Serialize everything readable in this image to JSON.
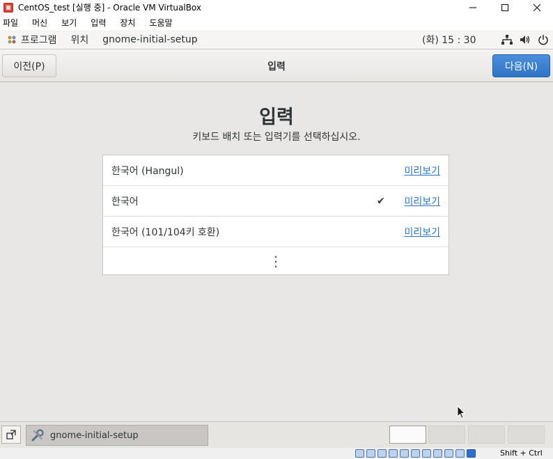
{
  "window": {
    "title": "CentOS_test [실행 중] - Oracle VM VirtualBox",
    "app_icon": "virtualbox-icon",
    "controls": [
      "minimize",
      "maximize",
      "close"
    ]
  },
  "vb_menu": {
    "items": [
      "파일",
      "머신",
      "보기",
      "입력",
      "장치",
      "도움말"
    ]
  },
  "gnome_top": {
    "apps_label": "프로그램",
    "places_label": "위치",
    "app_name": "gnome-initial-setup",
    "clock": "(화) 15 : 30",
    "status_icons": [
      "network-icon",
      "volume-icon",
      "power-icon"
    ]
  },
  "header": {
    "prev_label": "이전(P)",
    "title": "입력",
    "next_label": "다음(N)"
  },
  "page": {
    "heading": "입력",
    "description": "키보드 배치 또는 입력기를 선택하십시오."
  },
  "input_list": {
    "items": [
      {
        "label": "한국어 (Hangul)",
        "selected": false,
        "preview_label": "미리보기"
      },
      {
        "label": "한국어",
        "selected": true,
        "check_symbol": "✔",
        "preview_label": "미리보기"
      },
      {
        "label": "한국어 (101/104키 호환)",
        "selected": false,
        "preview_label": "미리보기"
      }
    ],
    "more_symbol": "⋮"
  },
  "taskbar": {
    "window_label": "gnome-initial-setup",
    "workspaces": [
      {
        "active": true
      },
      {
        "active": false
      },
      {
        "active": false
      },
      {
        "active": false
      }
    ]
  },
  "vb_status": {
    "host_key": "Shift + Ctrl"
  },
  "colors": {
    "accent_blue": "#2f74c9",
    "link_blue": "#2a76c6",
    "content_bg": "#e8e7e5",
    "text": "#2e3436"
  }
}
